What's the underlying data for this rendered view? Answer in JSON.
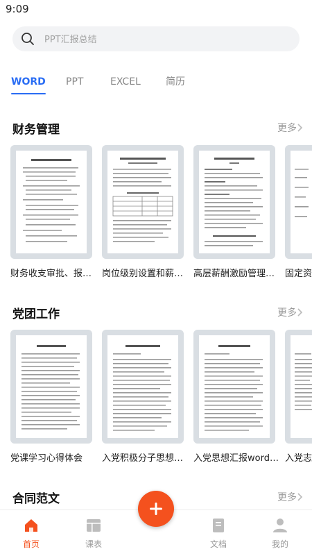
{
  "status": {
    "time": "9:09"
  },
  "search": {
    "placeholder": "PPT汇报总结"
  },
  "tabs": [
    {
      "label": "WORD",
      "active": true
    },
    {
      "label": "PPT",
      "active": false
    },
    {
      "label": "EXCEL",
      "active": false
    },
    {
      "label": "简历",
      "active": false
    }
  ],
  "sections": [
    {
      "title": "财务管理",
      "more": "更多",
      "items": [
        {
          "title": "财务收支审批、报销…"
        },
        {
          "title": "岗位级别设置和薪酬…"
        },
        {
          "title": "高层薪酬激励管理制…"
        },
        {
          "title": "固定资产"
        }
      ]
    },
    {
      "title": "党团工作",
      "more": "更多",
      "items": [
        {
          "title": "党课学习心得体会"
        },
        {
          "title": "入党积极分子思想汇…"
        },
        {
          "title": "入党思想汇报word…"
        },
        {
          "title": "入党志愿"
        }
      ]
    },
    {
      "title": "合同范文",
      "more": "更多"
    }
  ],
  "bottom_nav": [
    {
      "label": "首页",
      "icon": "home-icon",
      "active": true
    },
    {
      "label": "课表",
      "icon": "schedule-icon",
      "active": false
    },
    {
      "label": "文档",
      "icon": "document-icon",
      "active": false
    },
    {
      "label": "我的",
      "icon": "profile-icon",
      "active": false
    }
  ],
  "fab": {
    "icon": "plus-icon"
  },
  "colors": {
    "accent": "#2a6df4",
    "brand": "#f4511e",
    "inactive": "#999999"
  }
}
